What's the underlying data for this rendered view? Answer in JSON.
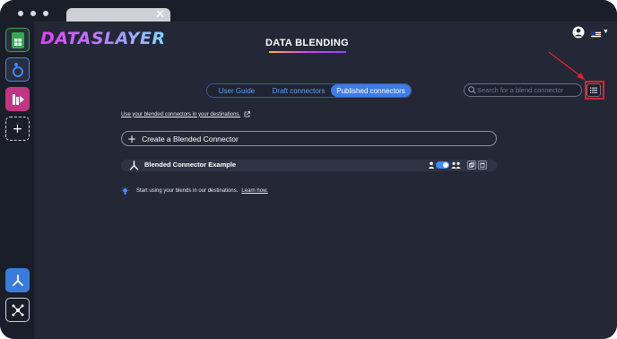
{
  "app": {
    "logo_text": "DATASLAYER",
    "page_title": "DATA BLENDING"
  },
  "header": {
    "user_icon": "user-circle-icon",
    "language_flag": "us-flag-icon"
  },
  "sidebar": {
    "items": [
      {
        "name": "google-sheets-icon",
        "color": "#34a853"
      },
      {
        "name": "looker-studio-icon",
        "color": "#4285f4"
      },
      {
        "name": "power-bi-icon",
        "color": "#c13584"
      },
      {
        "name": "add-icon",
        "color": "#ffffff"
      },
      {
        "name": "blend-icon",
        "color": "#3a7bdc"
      },
      {
        "name": "hub-icon",
        "color": "#ffffff"
      }
    ]
  },
  "tabs": [
    {
      "label": "User Guide",
      "active": false
    },
    {
      "label": "Draft connectors",
      "active": false
    },
    {
      "label": "Published connectors",
      "active": true
    }
  ],
  "search": {
    "placeholder": "Search for a blend connector",
    "value": ""
  },
  "use_link": {
    "text": "Use your blended connectors in your destinations."
  },
  "create": {
    "label": "Create a Blended Connector"
  },
  "connectors": [
    {
      "name": "Blended Connector Example",
      "published": true
    }
  ],
  "tip": {
    "text": "Start using your blends in our destinations.",
    "link": "Learn how."
  },
  "colors": {
    "background": "#242836",
    "accent": "#3f7be8",
    "highlight": "#e02030"
  }
}
